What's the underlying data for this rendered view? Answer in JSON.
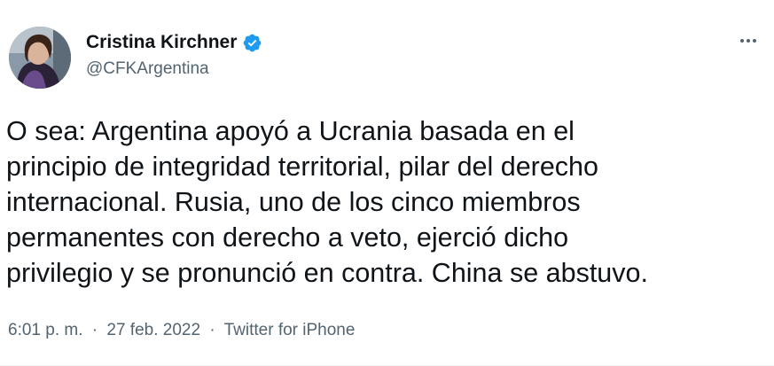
{
  "author": {
    "display_name": "Cristina Kirchner",
    "handle": "@CFKArgentina",
    "verified": true
  },
  "tweet": {
    "text_lines": [
      "O sea: Argentina apoyó a Ucrania basada en el",
      "principio de integridad territorial, pilar del derecho",
      "internacional. Rusia, uno de los cinco miembros",
      "permanentes con derecho a veto, ejerció dicho",
      "privilegio y se pronunció en contra. China se abstuvo."
    ]
  },
  "meta": {
    "time": "6:01 p. m.",
    "separator": "·",
    "date": "27 feb. 2022",
    "source": "Twitter for iPhone"
  },
  "colors": {
    "verified_badge": "#1d9bf0",
    "secondary_text": "#536471",
    "primary_text": "#0f1419"
  },
  "icons": {
    "verified": "verified-badge-icon",
    "more": "more-horizontal-icon"
  }
}
